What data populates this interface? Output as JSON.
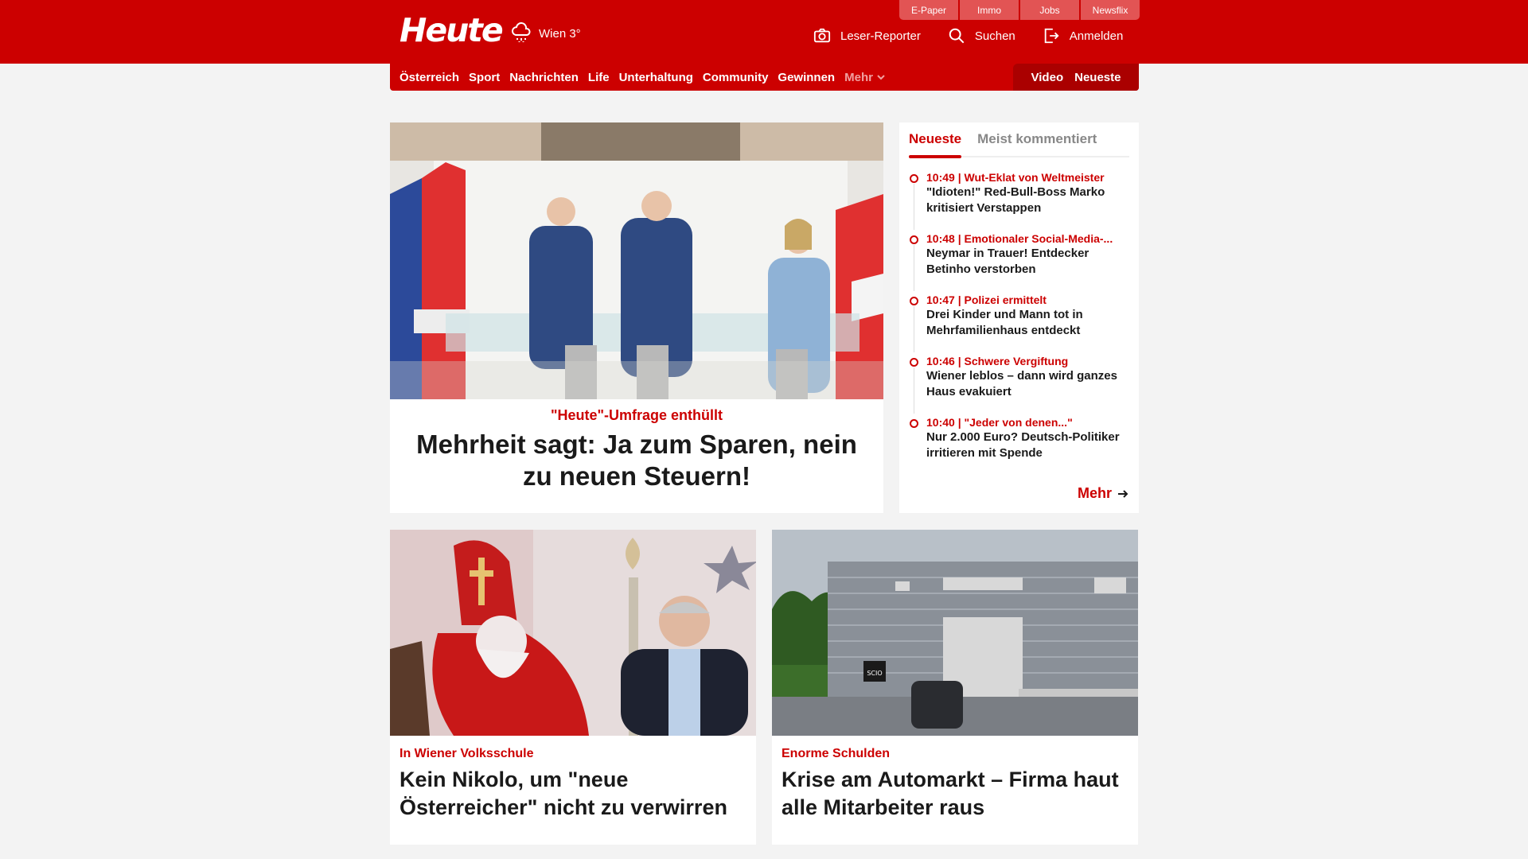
{
  "header": {
    "logo": "Heute",
    "weather": {
      "city_temp": "Wien 3°",
      "icon": "rain-cloud-icon"
    },
    "service_tabs": [
      "E-Paper",
      "Immo",
      "Jobs",
      "Newsflix"
    ],
    "actions": [
      {
        "label": "Leser-Reporter",
        "icon": "camera-icon"
      },
      {
        "label": "Suchen",
        "icon": "search-icon"
      },
      {
        "label": "Anmelden",
        "icon": "login-icon"
      }
    ]
  },
  "nav": {
    "items": [
      "Österreich",
      "Sport",
      "Nachrichten",
      "Life",
      "Unterhaltung",
      "Community",
      "Gewinnen"
    ],
    "more": "Mehr",
    "right": [
      "Video",
      "Neueste"
    ]
  },
  "hero": {
    "kicker": "\"Heute\"-Umfrage enthüllt",
    "title": "Mehrheit sagt: Ja zum Sparen, nein zu neuen Steuern!"
  },
  "sidebar": {
    "tabs": [
      "Neueste",
      "Meist kommentiert"
    ],
    "feed": [
      {
        "meta": "10:49 | Wut-Eklat von Weltmeister",
        "title": "\"Idioten!\" Red-Bull-Boss Marko kritisiert Verstappen"
      },
      {
        "meta": "10:48 | Emotionaler Social-Media-...",
        "title": "Neymar in Trauer! Entdecker Betinho verstorben"
      },
      {
        "meta": "10:47 | Polizei ermittelt",
        "title": "Drei Kinder und Mann tot in Mehrfamilienhaus entdeckt"
      },
      {
        "meta": "10:46 | Schwere Vergiftung",
        "title": "Wiener leblos – dann wird ganzes Haus evakuiert"
      },
      {
        "meta": "10:40 | \"Jeder von denen...\"",
        "title": "Nur 2.000 Euro? Deutsch-Politiker irritieren mit Spende"
      }
    ],
    "more": "Mehr"
  },
  "cards": [
    {
      "kicker": "In Wiener Volksschule",
      "title": "Kein Nikolo, um \"neue Österreicher\" nicht zu verwirren"
    },
    {
      "kicker": "Enorme Schulden",
      "title": "Krise am Automarkt – Firma haut alle Mitarbeiter raus",
      "sign": "SCIO"
    }
  ],
  "colors": {
    "brand": "#cc0000",
    "background": "#f3f3f3"
  }
}
